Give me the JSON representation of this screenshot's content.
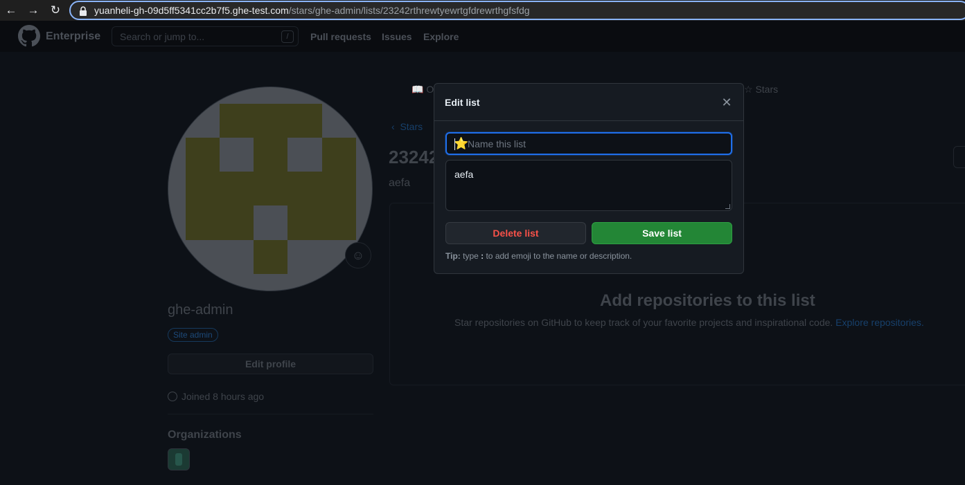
{
  "browser": {
    "url_host": "yuanheli-gh-09d5ff5341cc2b7f5.ghe-test.com",
    "url_path": "/stars/ghe-admin/lists/23242rthrewtyewrtgfdrewrthgfsfdg"
  },
  "header": {
    "brand": "Enterprise",
    "search_placeholder": "Search or jump to...",
    "search_shortcut": "/",
    "nav": [
      "Pull requests",
      "Issues",
      "Explore"
    ]
  },
  "profile": {
    "username": "ghe-admin",
    "badge": "Site admin",
    "edit_profile": "Edit profile",
    "joined": "Joined 8 hours ago",
    "organizations_title": "Organizations"
  },
  "page": {
    "tab_overview": "O",
    "tab_stars": "Stars",
    "back_link": "Stars",
    "list_title": "23242",
    "list_description": "aefa",
    "empty_title": "Add repositories to this list",
    "empty_text": "Star repositories on GitHub to keep track of your favorite projects and inspirational code.",
    "empty_link": "Explore repositories."
  },
  "modal": {
    "title": "Edit list",
    "name_placeholder": "Name this list",
    "name_emoji": "⭐",
    "description_value": "aefa",
    "delete_label": "Delete list",
    "save_label": "Save list",
    "tip_label": "Tip:",
    "tip_pre": " type ",
    "tip_colon": ":",
    "tip_post": " to add emoji to the name or description."
  }
}
